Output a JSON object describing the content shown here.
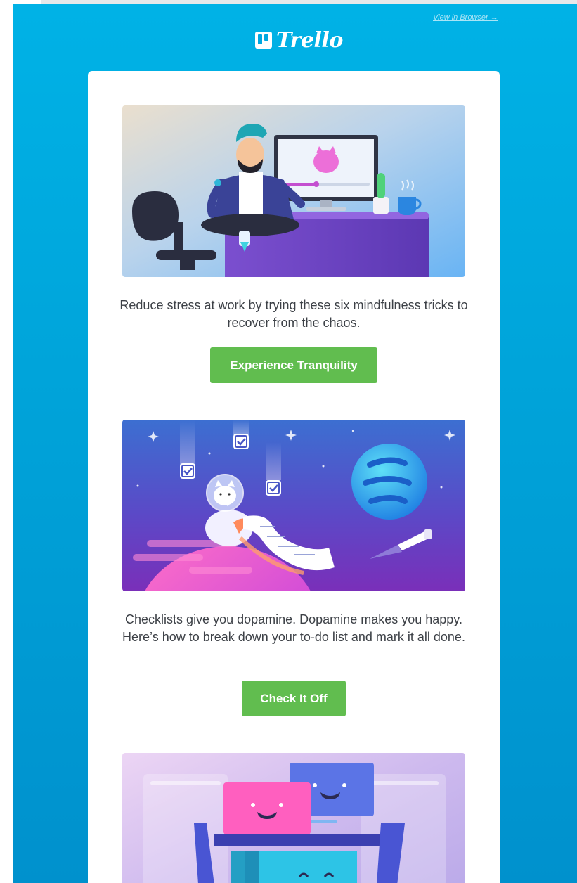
{
  "header": {
    "view_in_browser": "View in Browser →",
    "logo_text": "Trello"
  },
  "sections": [
    {
      "text": "Reduce stress at work by trying these six mindfulness tricks to recover from the chaos.",
      "button": "Experience Tranquility"
    },
    {
      "text": "Checklists give you dopamine. Dopamine makes you happy. Here’s how to break down your to-do list and mark it all done.",
      "button": "Check It Off"
    }
  ],
  "colors": {
    "brand_blue": "#00a8e0",
    "cta_green": "#61bd4f",
    "body_text": "#3d4147"
  }
}
